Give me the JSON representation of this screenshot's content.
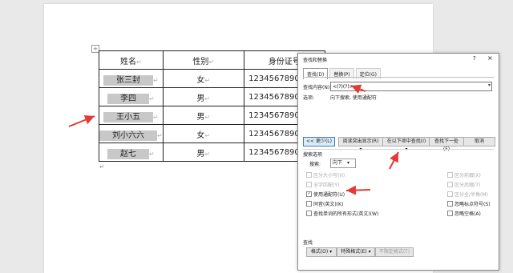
{
  "table": {
    "headers": [
      "姓名",
      "性别",
      "身份证号"
    ],
    "rows": [
      {
        "name": "张三封",
        "gender": "女",
        "id": "12345678901234"
      },
      {
        "name": "李四",
        "gender": "男",
        "id": "12345678901234"
      },
      {
        "name": "王小五",
        "gender": "男",
        "id": "12345678901234"
      },
      {
        "name": "刘小六六",
        "gender": "女",
        "id": "12345678901234"
      },
      {
        "name": "赵七",
        "gender": "男",
        "id": "12345678901234"
      }
    ],
    "cell_mark": "↵"
  },
  "dialog": {
    "title": "查找和替换",
    "help": "?",
    "close": "×",
    "tabs": [
      {
        "label": "查找(D)",
        "active": true
      },
      {
        "label": "替换(P)",
        "active": false
      },
      {
        "label": "定位(G)",
        "active": false
      }
    ],
    "find_label": "查找内容(N):",
    "find_value": "<(?)(?)>",
    "options_label": "选项:",
    "options_value": "向下搜索, 使用通配符",
    "buttons": {
      "less": "<< 更少(L)",
      "highlight": "阅读突出显示(R) ▾",
      "find_in": "在以下项中查找(I) ▾",
      "find_next": "查找下一处(F)",
      "cancel": "取消"
    },
    "search_options_label": "搜索选项",
    "search_label": "搜索:",
    "search_value": "向下",
    "left_options": [
      {
        "label": "区分大小写(H)",
        "checked": false,
        "disabled": true
      },
      {
        "label": "全字匹配(Y)",
        "checked": false,
        "disabled": true
      },
      {
        "label": "使用通配符(U)",
        "checked": true,
        "disabled": false
      },
      {
        "label": "同音(英文)(K)",
        "checked": false,
        "disabled": false
      },
      {
        "label": "查找单词的所有形式(英文)(W)",
        "checked": false,
        "disabled": false
      }
    ],
    "right_options": [
      {
        "label": "区分前缀(X)",
        "checked": false,
        "disabled": true
      },
      {
        "label": "区分后缀(T)",
        "checked": false,
        "disabled": true
      },
      {
        "label": "区分全/半角(M)",
        "checked": false,
        "disabled": true
      },
      {
        "label": "忽略标点符号(S)",
        "checked": false,
        "disabled": false
      },
      {
        "label": "忽略空格(A)",
        "checked": false,
        "disabled": false
      }
    ],
    "find_section_label": "查找",
    "format_button": "格式(O) ▾",
    "special_button": "特殊格式(E) ▾",
    "no_format_button": "不限定格式(T)"
  },
  "colors": {
    "annotation_arrow": "#e53935",
    "dialog_border": "#8a8a8a",
    "primary_button": "#3c7fb1"
  }
}
